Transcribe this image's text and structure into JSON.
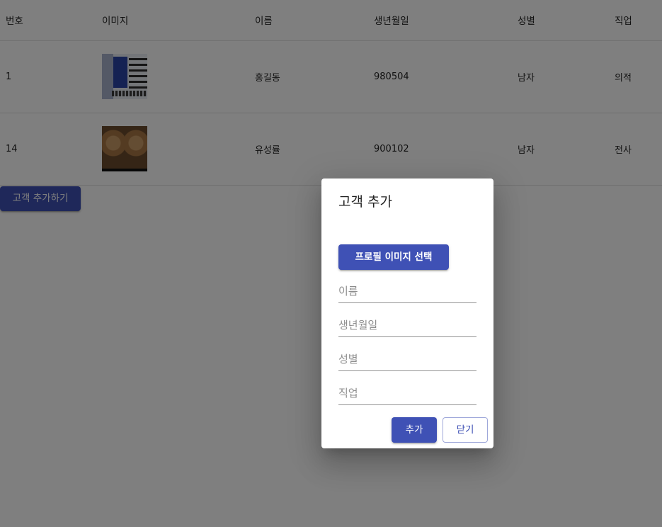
{
  "table": {
    "headers": [
      "번호",
      "이미지",
      "이름",
      "생년월일",
      "성별",
      "직업"
    ],
    "rows": [
      {
        "id": "1",
        "image": "building-photo",
        "name": "홍길동",
        "birthday": "980504",
        "gender": "남자",
        "job": "의적"
      },
      {
        "id": "14",
        "image": "cat-photo",
        "name": "유성률",
        "birthday": "900102",
        "gender": "남자",
        "job": "전사"
      }
    ]
  },
  "add_customer_button": "고객 추가하기",
  "dialog": {
    "title": "고객 추가",
    "file_button": "프로필 이미지 선택",
    "fields": {
      "name_placeholder": "이름",
      "birthday_placeholder": "생년월일",
      "gender_placeholder": "성별",
      "job_placeholder": "직업"
    },
    "submit_label": "추가",
    "close_label": "닫기"
  },
  "colors": {
    "primary": "#3f51b5",
    "backdrop": "rgba(0,0,0,0.5)"
  }
}
